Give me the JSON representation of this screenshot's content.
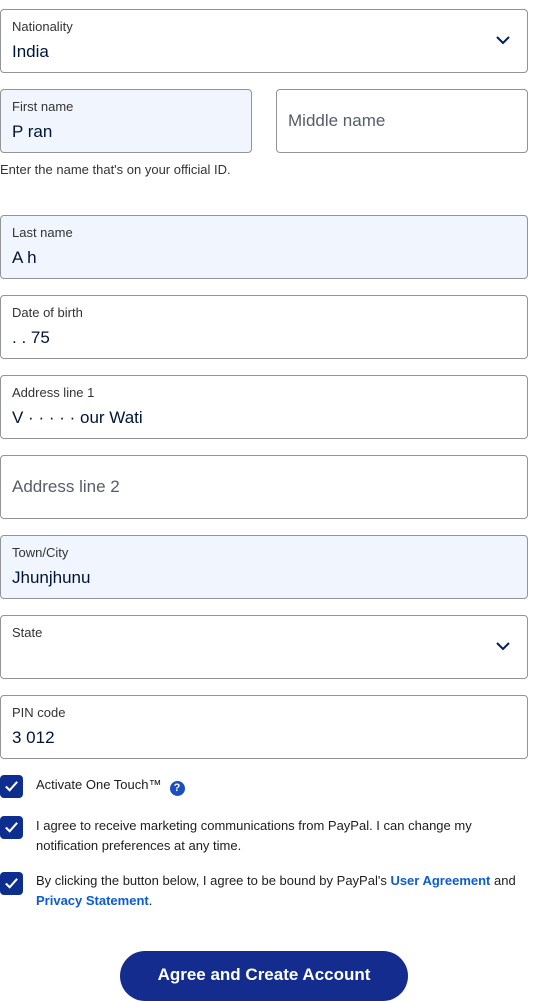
{
  "form": {
    "nationality": {
      "label": "Nationality",
      "value": "India"
    },
    "first_name": {
      "label": "First name",
      "value": "P ran"
    },
    "middle_name": {
      "placeholder": "Middle name"
    },
    "name_helper": "Enter the name that's on your official ID.",
    "last_name": {
      "label": "Last name",
      "value": "A  h"
    },
    "dob": {
      "label": "Date of birth",
      "value": "   .  .  75"
    },
    "address1": {
      "label": "Address line 1",
      "value": "V      · · ·      ·      ·     our Wati"
    },
    "address2": {
      "placeholder": "Address line 2"
    },
    "city": {
      "label": "Town/City",
      "value": "Jhunjhunu"
    },
    "state": {
      "label": "State",
      "value": ""
    },
    "pin": {
      "label": "PIN code",
      "value": "3  012"
    }
  },
  "checks": {
    "one_touch": {
      "text": "Activate One Touch™",
      "help_icon": "?"
    },
    "marketing": {
      "text": "I agree to receive marketing communications from PayPal. I can change my notification preferences at any time."
    },
    "agreement": {
      "text_before": "By clicking the button below, I agree to be bound by PayPal's ",
      "user_agreement": "User Agreement",
      "and": " and ",
      "privacy": "Privacy Statement",
      "period": "."
    }
  },
  "submit_label": "Agree and Create Account",
  "colors": {
    "primary": "#142c8e",
    "checkbox": "#0d2d8f",
    "link": "#0d5bd3",
    "filled_bg": "#f1f6fe"
  }
}
